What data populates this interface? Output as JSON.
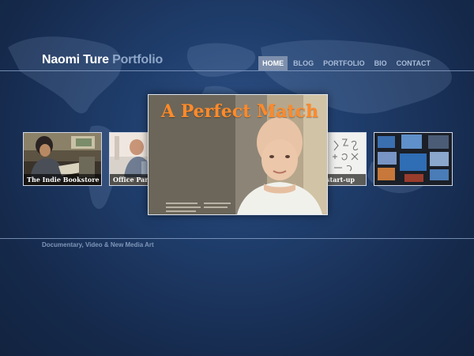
{
  "header": {
    "name": "Naomi Ture",
    "portfolio": "Portfolio"
  },
  "nav": {
    "items": [
      {
        "label": "HOME",
        "active": true
      },
      {
        "label": "BLOG",
        "active": false
      },
      {
        "label": "PORTFOLIO",
        "active": false
      },
      {
        "label": "BIO",
        "active": false
      },
      {
        "label": "CONTACT",
        "active": false
      }
    ]
  },
  "carousel": {
    "thumbs": [
      {
        "caption": "The Indie Bookstore"
      },
      {
        "caption": "Office Paro"
      },
      {
        "caption": "start-up"
      },
      {
        "caption": ""
      }
    ],
    "feature": {
      "title": "A Perfect Match"
    }
  },
  "footer": {
    "tagline": "Documentary, Video & New Media Art"
  },
  "colors": {
    "accent_orange": "#ff8a2a",
    "nav_active_bg": "#7d8fac",
    "background": "#1f3d6b"
  }
}
